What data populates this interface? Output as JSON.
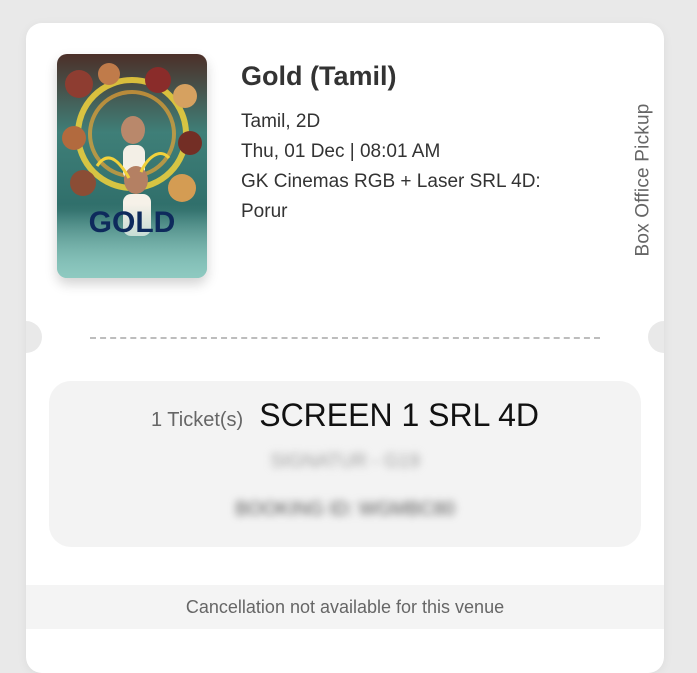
{
  "movie": {
    "poster_title": "GOLD",
    "title": "Gold (Tamil)",
    "language_format": "Tamil, 2D",
    "datetime": "Thu, 01 Dec | 08:01 AM",
    "venue": "GK Cinemas RGB + Laser SRL 4D: Porur"
  },
  "pickup": {
    "label": "Box Office Pickup"
  },
  "ticket": {
    "count_label": "1 Ticket(s)",
    "screen": "SCREEN 1 SRL 4D",
    "seat_info": "SIGNATUR - G19",
    "booking_id": "BOOKING ID: WGMBC80"
  },
  "footer": {
    "cancellation_text": "Cancellation not available for this venue"
  },
  "colors": {
    "card_background": "#ffffff",
    "page_background": "#e9e9e9",
    "ticket_box_background": "#f3f3f3",
    "poster_title_color": "#0e2a5c"
  }
}
